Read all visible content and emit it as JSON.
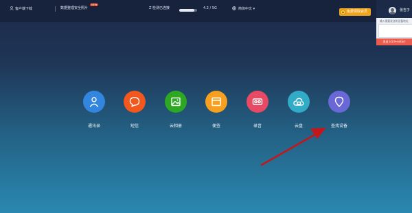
{
  "topbar": {
    "download_label": "客户端下载",
    "migrate_label": "数据整理安全照片",
    "badge": "NEW",
    "device_name": "Z 检测已连接",
    "storage": {
      "text": "4.2 / 5G",
      "fraction": 0.84
    },
    "language": "简体中文",
    "vip_label": "免费领取会员",
    "username": "张吉子"
  },
  "side_panel": {
    "hint": "输入需要发送的设备地址",
    "send_label": "发送 (ctrl+enter)"
  },
  "apps": [
    {
      "label": "通讯录",
      "color": "#3386df",
      "icon": "contacts-icon"
    },
    {
      "label": "短信",
      "color": "#f2581d",
      "icon": "message-icon"
    },
    {
      "label": "云相册",
      "color": "#2ea823",
      "icon": "photo-icon"
    },
    {
      "label": "便签",
      "color": "#f7a020",
      "icon": "note-icon"
    },
    {
      "label": "录音",
      "color": "#e84a63",
      "icon": "recorder-icon"
    },
    {
      "label": "云盘",
      "color": "#32abc7",
      "icon": "cloud-drive-icon"
    },
    {
      "label": "查找设备",
      "color": "#6a68d6",
      "icon": "location-pin-icon"
    }
  ],
  "colors": {
    "annotation_arrow": "#c4171b",
    "vip": "#f0a41a"
  }
}
